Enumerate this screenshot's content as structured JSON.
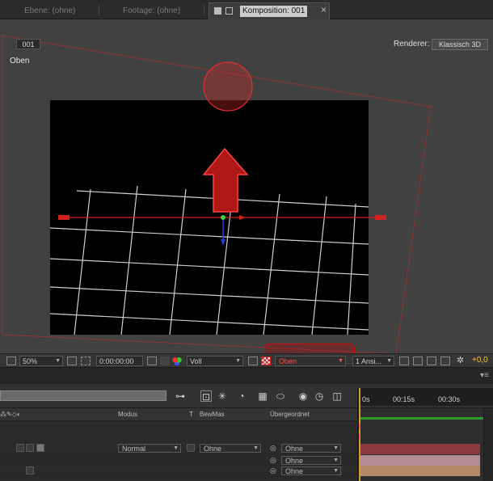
{
  "tabs": {
    "ebene": "Ebene: (ohne)",
    "footage": "Footage: (ohne)",
    "komposition": "Komposition: 001",
    "close": "×"
  },
  "viewer": {
    "comp_name": "001",
    "renderer_label": "Renderer:",
    "renderer_value": "Klassisch 3D",
    "view_label": "Oben"
  },
  "viewer_toolbar": {
    "zoom": "50%",
    "timecode": "0:00:00:00",
    "resolution": "Voll",
    "view": "Oben",
    "views_count": "1 Ansi...",
    "exposure": "+0,0"
  },
  "timeline": {
    "ruler": [
      "0s",
      "00:15s",
      "00:30s"
    ],
    "headers": {
      "modus": "Modus",
      "t": "T",
      "bewmas": "BewMas",
      "uebergeordnet": "Übergeordnet"
    },
    "layers": [
      {
        "modus": "Normal",
        "bewmas": "Ohne",
        "parent": "Ohne",
        "color": "#8a3a3a"
      },
      {
        "modus": "",
        "bewmas": "",
        "parent": "Ohne",
        "color": "#b48a94"
      },
      {
        "modus": "",
        "bewmas": "",
        "parent": "Ohne",
        "color": "#b48a6a"
      }
    ]
  },
  "colors": {
    "accent_red": "#d81f1f",
    "exposure_color": "#f0c040",
    "workarea_green": "#2e9a2e"
  },
  "icons": {
    "switch": "arrow-swap-icon",
    "grid": "grid-icon",
    "camera": "camera-icon",
    "color": "rgb-icon",
    "transparency": "checkerboard-icon"
  }
}
